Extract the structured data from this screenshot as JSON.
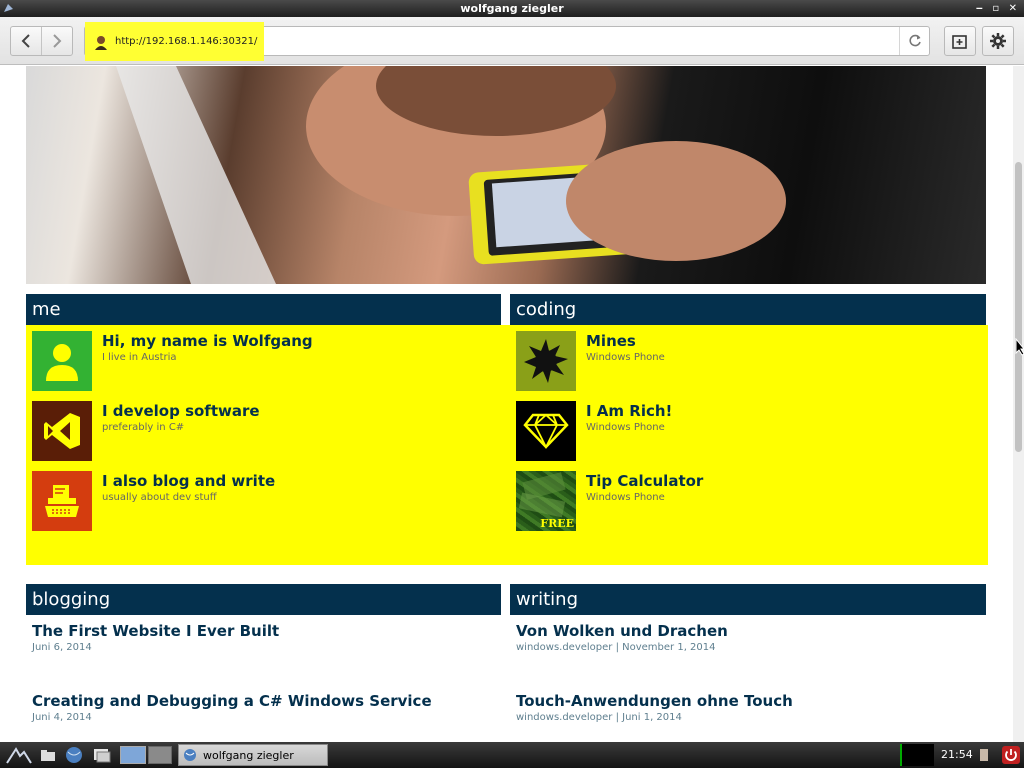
{
  "window": {
    "title": "wolfgang ziegler"
  },
  "browser": {
    "url": "http://192.168.1.146:30321/"
  },
  "sections": {
    "me": {
      "title": "me",
      "items": [
        {
          "title": "Hi, my name is Wolfgang",
          "subtitle": "I live in Austria",
          "icon": "person-icon",
          "color": "#33b233"
        },
        {
          "title": "I develop software",
          "subtitle": "preferably in C#",
          "icon": "visual-studio-icon",
          "color": "#5a1e07"
        },
        {
          "title": "I also blog and write",
          "subtitle": "usually about dev stuff",
          "icon": "typewriter-icon",
          "color": "#d43d0f"
        }
      ]
    },
    "coding": {
      "title": "coding",
      "items": [
        {
          "title": "Mines",
          "subtitle": "Windows Phone",
          "icon": "mine-icon"
        },
        {
          "title": "I Am Rich!",
          "subtitle": "Windows Phone",
          "icon": "diamond-icon"
        },
        {
          "title": "Tip Calculator",
          "subtitle": "Windows Phone",
          "icon": "money-icon",
          "badge": "FREE"
        }
      ]
    },
    "blogging": {
      "title": "blogging",
      "posts": [
        {
          "title": "The First Website I Ever Built",
          "meta": "Juni 6, 2014"
        },
        {
          "title": "Creating and Debugging a C# Windows Service",
          "meta": "Juni 4, 2014"
        }
      ]
    },
    "writing": {
      "title": "writing",
      "posts": [
        {
          "title": "Von Wolken und Drachen",
          "meta": "windows.developer | November 1, 2014"
        },
        {
          "title": "Touch-Anwendungen ohne Touch",
          "meta": "windows.developer | Juni 1, 2014"
        }
      ]
    }
  },
  "taskbar": {
    "task_label": "wolfgang ziegler",
    "clock": "21:54"
  },
  "colors": {
    "accent": "#04304d",
    "highlight": "#ffff00"
  }
}
